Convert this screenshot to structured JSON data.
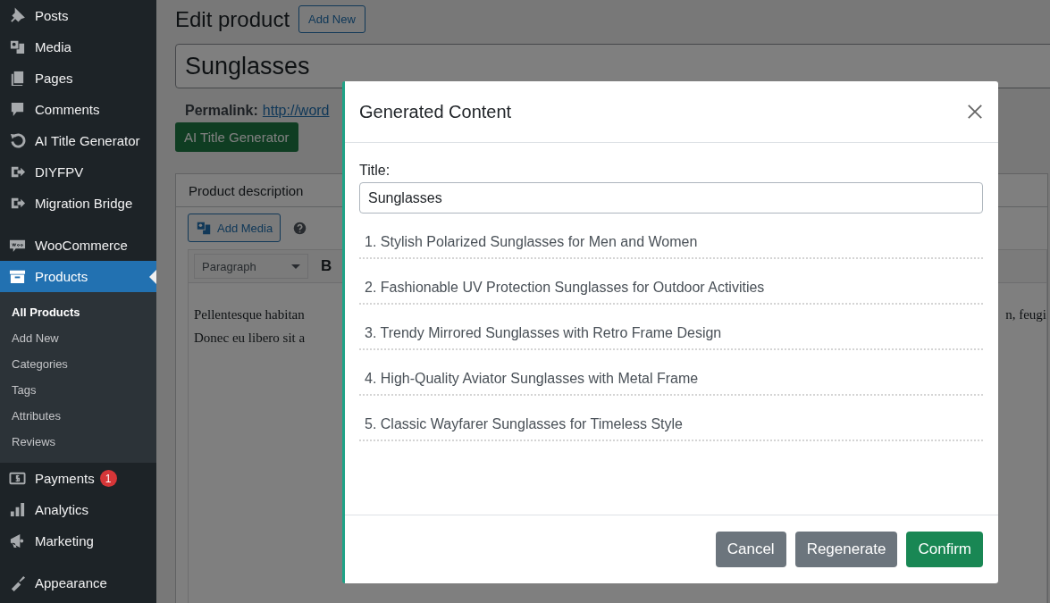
{
  "sidebar": {
    "groups": [
      [
        {
          "label": "Posts",
          "selected": false
        },
        {
          "label": "Media",
          "selected": false
        },
        {
          "label": "Pages",
          "selected": false
        },
        {
          "label": "Comments",
          "selected": false
        },
        {
          "label": "AI Title Generator",
          "selected": false
        },
        {
          "label": "DIYFPV",
          "selected": false
        },
        {
          "label": "Migration Bridge",
          "selected": false
        }
      ],
      [
        {
          "label": "WooCommerce",
          "selected": false
        },
        {
          "label": "Products",
          "selected": true,
          "children": [
            {
              "label": "All Products",
              "selected": true
            },
            {
              "label": "Add New",
              "selected": false
            },
            {
              "label": "Categories",
              "selected": false
            },
            {
              "label": "Tags",
              "selected": false
            },
            {
              "label": "Attributes",
              "selected": false
            },
            {
              "label": "Reviews",
              "selected": false
            }
          ]
        },
        {
          "label": "Payments",
          "selected": false,
          "badge": "1"
        },
        {
          "label": "Analytics",
          "selected": false
        },
        {
          "label": "Marketing",
          "selected": false
        }
      ],
      [
        {
          "label": "Appearance",
          "selected": false
        }
      ]
    ]
  },
  "page": {
    "heading": "Edit product",
    "add_new": "Add New",
    "title_value": "Sunglasses",
    "permalink_label": "Permalink:",
    "permalink_url": "http://word",
    "ai_button": "AI Title Generator",
    "description": {
      "title": "Product description",
      "add_media": "Add Media",
      "format": "Paragraph",
      "bold_button": "B",
      "text_left": [
        "Pellentesque habitan",
        "Donec eu libero sit a"
      ],
      "text_right": "n, feugi"
    }
  },
  "modal": {
    "title": "Generated Content",
    "field_label": "Title:",
    "field_value": "Sunglasses",
    "suggestions": [
      "1. Stylish Polarized Sunglasses for Men and Women",
      "2. Fashionable UV Protection Sunglasses for Outdoor Activities",
      "3. Trendy Mirrored Sunglasses with Retro Frame Design",
      "4. High-Quality Aviator Sunglasses with Metal Frame",
      "5. Classic Wayfarer Sunglasses for Timeless Style"
    ],
    "buttons": [
      {
        "label": "Cancel",
        "kind": "secondary"
      },
      {
        "label": "Regenerate",
        "kind": "secondary"
      },
      {
        "label": "Confirm",
        "kind": "primary"
      }
    ]
  }
}
